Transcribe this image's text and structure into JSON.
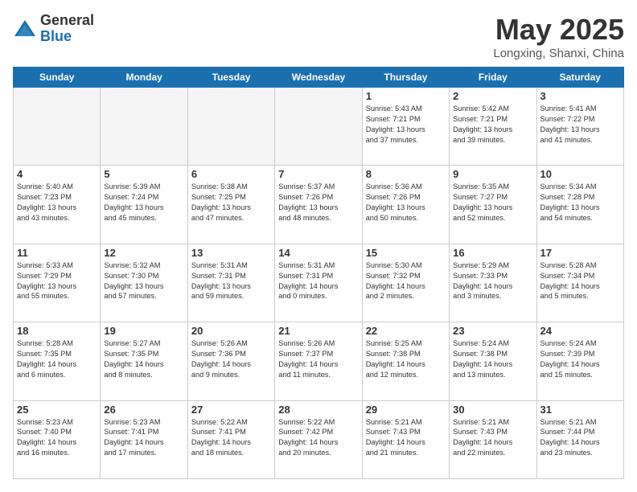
{
  "header": {
    "logo_general": "General",
    "logo_blue": "Blue",
    "title": "May 2025",
    "location": "Longxing, Shanxi, China"
  },
  "days_of_week": [
    "Sunday",
    "Monday",
    "Tuesday",
    "Wednesday",
    "Thursday",
    "Friday",
    "Saturday"
  ],
  "weeks": [
    [
      {
        "day": "",
        "info": ""
      },
      {
        "day": "",
        "info": ""
      },
      {
        "day": "",
        "info": ""
      },
      {
        "day": "",
        "info": ""
      },
      {
        "day": "1",
        "info": "Sunrise: 5:43 AM\nSunset: 7:21 PM\nDaylight: 13 hours\nand 37 minutes."
      },
      {
        "day": "2",
        "info": "Sunrise: 5:42 AM\nSunset: 7:21 PM\nDaylight: 13 hours\nand 39 minutes."
      },
      {
        "day": "3",
        "info": "Sunrise: 5:41 AM\nSunset: 7:22 PM\nDaylight: 13 hours\nand 41 minutes."
      }
    ],
    [
      {
        "day": "4",
        "info": "Sunrise: 5:40 AM\nSunset: 7:23 PM\nDaylight: 13 hours\nand 43 minutes."
      },
      {
        "day": "5",
        "info": "Sunrise: 5:39 AM\nSunset: 7:24 PM\nDaylight: 13 hours\nand 45 minutes."
      },
      {
        "day": "6",
        "info": "Sunrise: 5:38 AM\nSunset: 7:25 PM\nDaylight: 13 hours\nand 47 minutes."
      },
      {
        "day": "7",
        "info": "Sunrise: 5:37 AM\nSunset: 7:26 PM\nDaylight: 13 hours\nand 48 minutes."
      },
      {
        "day": "8",
        "info": "Sunrise: 5:36 AM\nSunset: 7:26 PM\nDaylight: 13 hours\nand 50 minutes."
      },
      {
        "day": "9",
        "info": "Sunrise: 5:35 AM\nSunset: 7:27 PM\nDaylight: 13 hours\nand 52 minutes."
      },
      {
        "day": "10",
        "info": "Sunrise: 5:34 AM\nSunset: 7:28 PM\nDaylight: 13 hours\nand 54 minutes."
      }
    ],
    [
      {
        "day": "11",
        "info": "Sunrise: 5:33 AM\nSunset: 7:29 PM\nDaylight: 13 hours\nand 55 minutes."
      },
      {
        "day": "12",
        "info": "Sunrise: 5:32 AM\nSunset: 7:30 PM\nDaylight: 13 hours\nand 57 minutes."
      },
      {
        "day": "13",
        "info": "Sunrise: 5:31 AM\nSunset: 7:31 PM\nDaylight: 13 hours\nand 59 minutes."
      },
      {
        "day": "14",
        "info": "Sunrise: 5:31 AM\nSunset: 7:31 PM\nDaylight: 14 hours\nand 0 minutes."
      },
      {
        "day": "15",
        "info": "Sunrise: 5:30 AM\nSunset: 7:32 PM\nDaylight: 14 hours\nand 2 minutes."
      },
      {
        "day": "16",
        "info": "Sunrise: 5:29 AM\nSunset: 7:33 PM\nDaylight: 14 hours\nand 3 minutes."
      },
      {
        "day": "17",
        "info": "Sunrise: 5:28 AM\nSunset: 7:34 PM\nDaylight: 14 hours\nand 5 minutes."
      }
    ],
    [
      {
        "day": "18",
        "info": "Sunrise: 5:28 AM\nSunset: 7:35 PM\nDaylight: 14 hours\nand 6 minutes."
      },
      {
        "day": "19",
        "info": "Sunrise: 5:27 AM\nSunset: 7:35 PM\nDaylight: 14 hours\nand 8 minutes."
      },
      {
        "day": "20",
        "info": "Sunrise: 5:26 AM\nSunset: 7:36 PM\nDaylight: 14 hours\nand 9 minutes."
      },
      {
        "day": "21",
        "info": "Sunrise: 5:26 AM\nSunset: 7:37 PM\nDaylight: 14 hours\nand 11 minutes."
      },
      {
        "day": "22",
        "info": "Sunrise: 5:25 AM\nSunset: 7:38 PM\nDaylight: 14 hours\nand 12 minutes."
      },
      {
        "day": "23",
        "info": "Sunrise: 5:24 AM\nSunset: 7:38 PM\nDaylight: 14 hours\nand 13 minutes."
      },
      {
        "day": "24",
        "info": "Sunrise: 5:24 AM\nSunset: 7:39 PM\nDaylight: 14 hours\nand 15 minutes."
      }
    ],
    [
      {
        "day": "25",
        "info": "Sunrise: 5:23 AM\nSunset: 7:40 PM\nDaylight: 14 hours\nand 16 minutes."
      },
      {
        "day": "26",
        "info": "Sunrise: 5:23 AM\nSunset: 7:41 PM\nDaylight: 14 hours\nand 17 minutes."
      },
      {
        "day": "27",
        "info": "Sunrise: 5:22 AM\nSunset: 7:41 PM\nDaylight: 14 hours\nand 18 minutes."
      },
      {
        "day": "28",
        "info": "Sunrise: 5:22 AM\nSunset: 7:42 PM\nDaylight: 14 hours\nand 20 minutes."
      },
      {
        "day": "29",
        "info": "Sunrise: 5:21 AM\nSunset: 7:43 PM\nDaylight: 14 hours\nand 21 minutes."
      },
      {
        "day": "30",
        "info": "Sunrise: 5:21 AM\nSunset: 7:43 PM\nDaylight: 14 hours\nand 22 minutes."
      },
      {
        "day": "31",
        "info": "Sunrise: 5:21 AM\nSunset: 7:44 PM\nDaylight: 14 hours\nand 23 minutes."
      }
    ]
  ]
}
